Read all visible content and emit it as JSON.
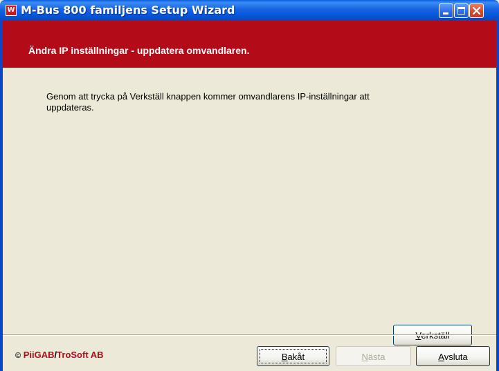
{
  "window": {
    "title": "M-Bus 800 familjens Setup Wizard",
    "app_icon_letter": "W",
    "controls": {
      "minimize": "minimize-icon",
      "maximize": "maximize-icon",
      "close": "close-icon"
    }
  },
  "header": {
    "title": "Ändra IP inställningar - uppdatera omvandlaren.",
    "background_color": "#b30b17"
  },
  "content": {
    "description": "Genom att trycka på Verkställ knappen kommer omvandlarens IP-inställningar att uppdateras.",
    "apply_button": {
      "prefix": "",
      "accel": "V",
      "rest": "erkställ"
    }
  },
  "footer": {
    "brand_mark": "©",
    "brand_a": "PiiGAB",
    "brand_sep": "/",
    "brand_b": "TroSoft AB",
    "back_button": {
      "prefix": "",
      "accel": "B",
      "rest": "akåt"
    },
    "next_button": {
      "prefix": "",
      "accel": "N",
      "rest": "ästa",
      "enabled": false
    },
    "exit_button": {
      "prefix": "",
      "accel": "A",
      "rest": "vsluta"
    }
  }
}
